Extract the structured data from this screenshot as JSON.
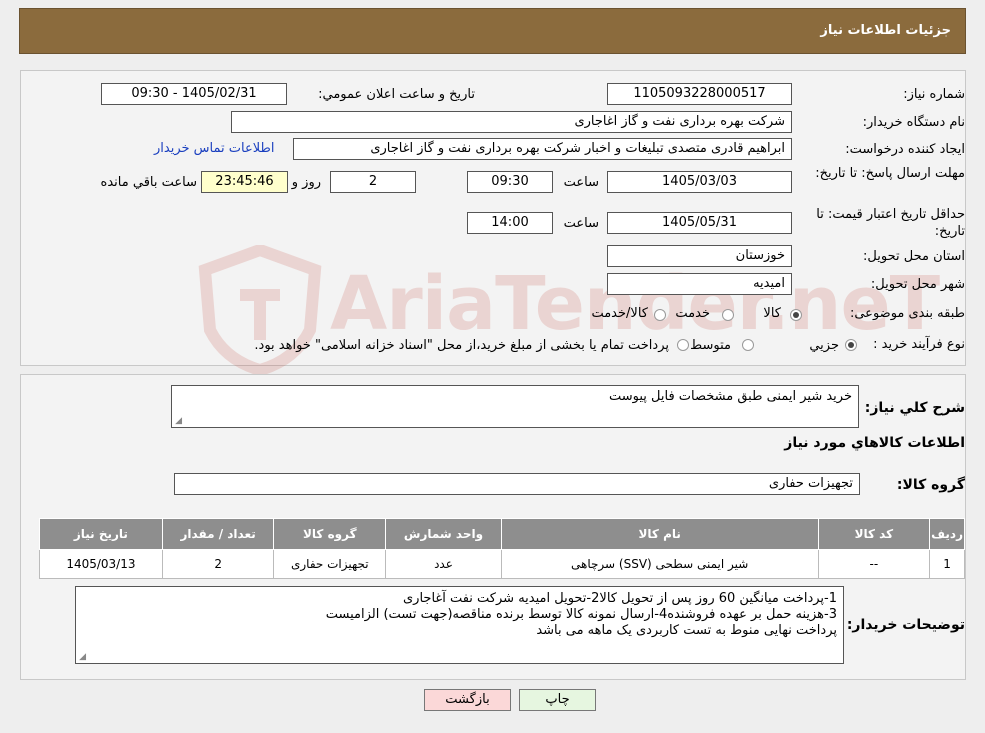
{
  "header": {
    "title": "جزئیات اطلاعات نیاز"
  },
  "form": {
    "need_number_label": "شماره نیاز:",
    "need_number": "1105093228000517",
    "announce_label": "تاریخ و ساعت اعلان عمومي:",
    "announce_value": "1405/02/31 - 09:30",
    "buyer_org_label": "نام دستگاه خریدار:",
    "buyer_org": "شرکت بهره برداری نفت و گاز اغاجاری",
    "requester_label": "ایجاد کننده درخواست:",
    "requester": "ابراهیم قادری متصدی تبلیغات و اخبار شرکت بهره برداری نفت و گاز اغاجاری",
    "contact_link": "اطلاعات تماس خریدار",
    "reply_deadline_label": "مهلت ارسال پاسخ: تا تاریخ:",
    "reply_date": "1405/03/03",
    "time_label": "ساعت",
    "reply_time": "09:30",
    "days_value": "2",
    "days_label": "روز و",
    "remaining_time": "23:45:46",
    "remaining_label": "ساعت باقي مانده",
    "validity_label": "حداقل تاریخ اعتبار قیمت: تا تاریخ:",
    "validity_date": "1405/05/31",
    "validity_time": "14:00",
    "province_label": "استان محل تحویل:",
    "province": "خوزستان",
    "city_label": "شهر محل تحویل:",
    "city": "امیدیه",
    "category_label": "طبقه بندی موضوعی:",
    "category_options": [
      "کالا",
      "خدمت",
      "کالا/خدمت"
    ],
    "category_selected": 0,
    "process_label": "نوع فرآیند خرید :",
    "process_options": [
      "جزیي",
      "متوسط",
      "پرداخت تمام یا بخشی از مبلغ خرید،از محل \"اسناد خزانه اسلامی\" خواهد بود."
    ],
    "process_selected": 0
  },
  "details": {
    "description_label": "شرح کلي نیاز:",
    "description": "خرید شیر ایمنی طبق مشخصات فایل پیوست",
    "goods_info_title": "اطلاعات کالاهاي مورد نیاز",
    "goods_group_label": "گروه کالا:",
    "goods_group": "تجهیزات حفاری",
    "table": {
      "headers": [
        "ردیف",
        "کد کالا",
        "نام کالا",
        "واحد شمارش",
        "گروه کالا",
        "تعداد / مقدار",
        "تاریخ نیاز"
      ],
      "rows": [
        [
          "1",
          "--",
          "شیر ایمنی سطحی (SSV) سرچاهی",
          "عدد",
          "تجهیزات حفاری",
          "2",
          "1405/03/13"
        ]
      ]
    },
    "buyer_notes_label": "توضیحات خریدار:",
    "buyer_notes": [
      "1-پرداخت میانگین 60 روز پس از تحویل کالا2-تحویل امیدیه شرکت نفت آغاجاری",
      "3-هزینه حمل بر عهده فروشنده4-ارسال نمونه کالا توسط برنده مناقصه(جهت تست) الزامیست",
      "پرداخت نهایی منوط به تست کاربردی یک ماهه می باشد"
    ]
  },
  "buttons": {
    "print": "چاپ",
    "back": "بازگشت"
  },
  "colors": {
    "header_bg": "#8b6b3d",
    "table_header_bg": "#8e8e8e",
    "back_button_bg": "#fbd8d8",
    "print_button_bg": "#e6f6e0"
  }
}
